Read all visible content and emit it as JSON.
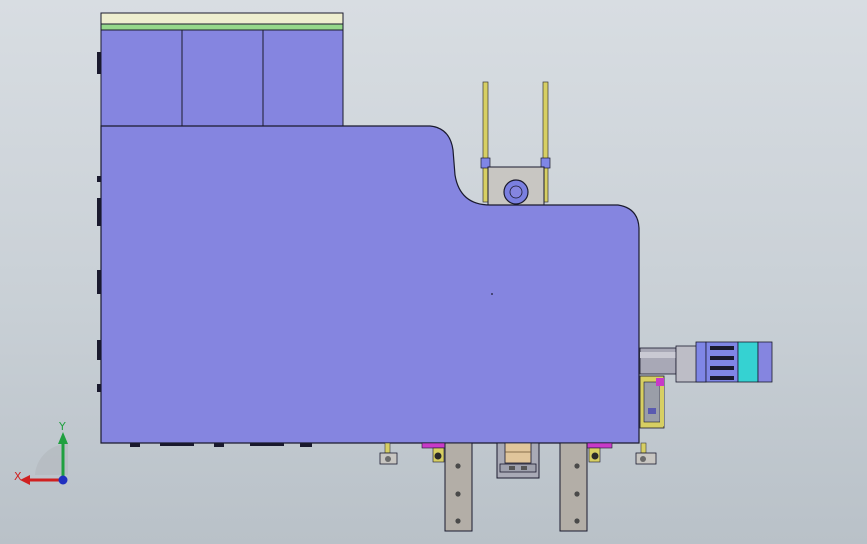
{
  "viewport": {
    "background_top": "#d8dde2",
    "background_bottom": "#b9c1c8"
  },
  "model": {
    "body_color": "#8585e0",
    "outline_color": "#1a1a2e",
    "rail_color": "#d7cf63",
    "bracket_color": "#a8a29a",
    "motor_cyan": "#35d2d2",
    "motor_body": "#7f86e6",
    "accent_magenta": "#c83ac8"
  },
  "triad": {
    "x_label": "X",
    "y_label": "Y",
    "x_color": "#d02020",
    "y_color": "#20a040",
    "z_color": "#2030c0",
    "icons": [
      "x-axis-arrow-icon",
      "y-axis-arrow-icon",
      "z-axis-dot-icon"
    ]
  }
}
